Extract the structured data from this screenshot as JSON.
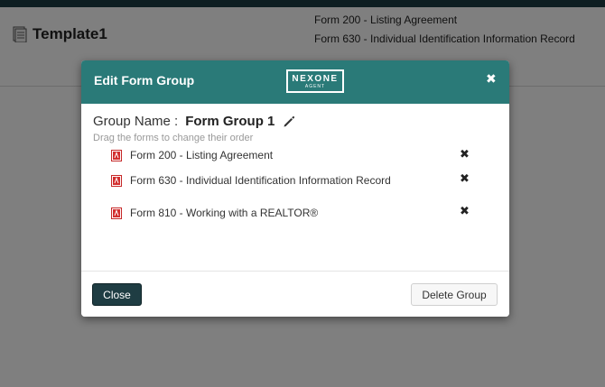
{
  "background": {
    "page_title": "Template1",
    "forms": [
      "Form 200 - Listing Agreement",
      "Form 630 - Individual Identification Information Record"
    ]
  },
  "modal": {
    "title": "Edit Form Group",
    "logo": {
      "brand": "NEXONE",
      "sub": "AGENT"
    },
    "close_icon": "close-icon",
    "group_label": "Group Name :",
    "group_name": "Form Group 1",
    "hint": "Drag the forms to change their order",
    "forms": [
      {
        "label": "Form 200 - Listing Agreement"
      },
      {
        "label": "Form 630 - Individual Identification Information Record"
      },
      {
        "label": "Form 810 - Working with a REALTOR®"
      }
    ],
    "close_button": "Close",
    "delete_button": "Delete Group"
  },
  "colors": {
    "header": "#2a7a78",
    "close_button": "#1f3d43",
    "topbar": "#1c3d45"
  }
}
